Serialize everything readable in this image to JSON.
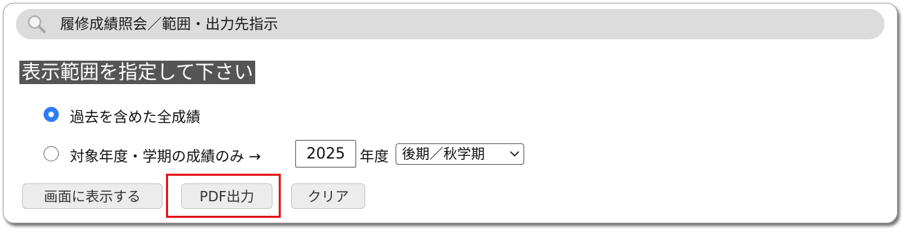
{
  "header": {
    "title": "履修成績照会／範囲・出力先指示",
    "icon": "search-icon"
  },
  "section": {
    "heading": "表示範囲を指定して下さい"
  },
  "options": {
    "all": {
      "label": "過去を含めた全成績",
      "selected": true
    },
    "term": {
      "label": "対象年度・学期の成績のみ →",
      "selected": false,
      "year_value": "2025",
      "year_suffix": "年度",
      "term_selected": "後期／秋学期"
    }
  },
  "buttons": {
    "show": "画面に表示する",
    "pdf": "PDF出力",
    "clear": "クリア"
  },
  "colors": {
    "radio_accent": "#2f7cf6",
    "heading_bg": "#555555",
    "highlight": "#e4141b"
  }
}
